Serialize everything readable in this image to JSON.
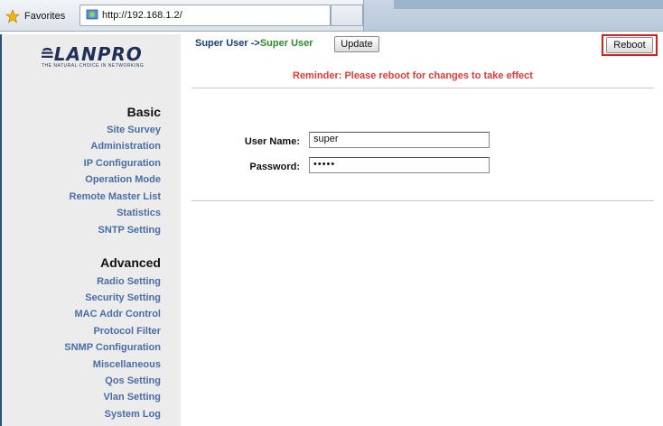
{
  "browser": {
    "favorites_label": "Favorites",
    "address": "http://192.168.1.2/"
  },
  "brand": {
    "logo_text": "LANPRO",
    "tagline": "THE NATURAL CHOICE IN NETWORKING",
    "accent_color": "#4a6da8",
    "highlight_color": "#d91e1e"
  },
  "sidebar": {
    "basic_title": "Basic",
    "basic_items": [
      "Site Survey",
      "Administration",
      "IP Configuration",
      "Operation Mode",
      "Remote Master List",
      "Statistics",
      "SNTP Setting"
    ],
    "advanced_title": "Advanced",
    "advanced_items": [
      "Radio Setting",
      "Security Setting",
      "MAC Addr Control",
      "Protocol Filter",
      "SNMP Configuration",
      "Miscellaneous",
      "Qos Setting",
      "Vlan Setting",
      "System Log"
    ]
  },
  "header": {
    "breadcrumb_parent": "Super User ->",
    "breadcrumb_current": "Super User",
    "update_label": "Update",
    "reboot_label": "Reboot",
    "reminder": "Reminder: Please reboot for changes to take effect"
  },
  "form": {
    "username_label": "User Name:",
    "username_value": "super",
    "password_label": "Password:",
    "password_value": "•••••"
  }
}
